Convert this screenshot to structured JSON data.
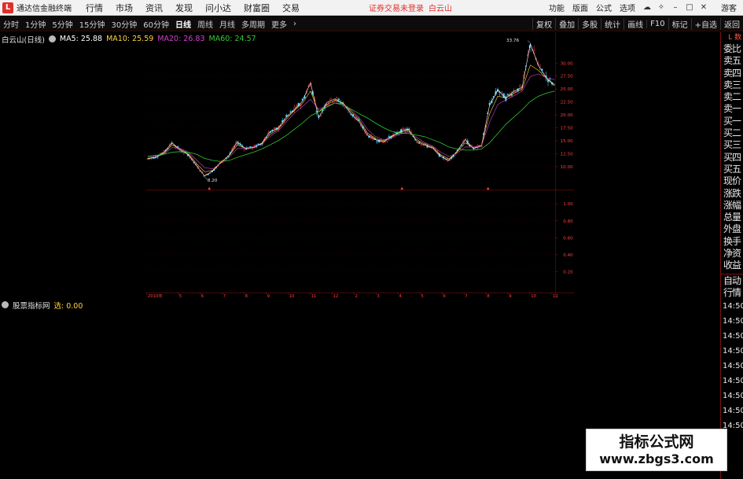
{
  "menubar": {
    "logo": "L",
    "app_title": "通达信金融终端",
    "items": [
      "行情",
      "市场",
      "资讯",
      "发现",
      "问小达",
      "财富圈",
      "交易"
    ],
    "login_status": "证券交易未登录",
    "login_stock": "白云山",
    "right_items": [
      "功能",
      "版面",
      "公式",
      "选项"
    ],
    "guest": "游客"
  },
  "toolbar": {
    "periods": [
      "分时",
      "1分钟",
      "5分钟",
      "15分钟",
      "30分钟",
      "60分钟",
      "日线",
      "周线",
      "月线",
      "多周期",
      "更多"
    ],
    "active_period": "日线",
    "right_buttons": [
      "复权",
      "叠加",
      "多股",
      "统计",
      "画线",
      "F10",
      "标记",
      "+自选",
      "返回"
    ]
  },
  "main_legend": {
    "name": "白云山(日线)",
    "ma5_label": "MA5: 25.88",
    "ma10_label": "MA10: 25.59",
    "ma20_label": "MA20: 26.83",
    "ma60_label": "MA60: 24.57"
  },
  "sub_legend": {
    "name": "股票指标网",
    "value_label": "选: 0.00"
  },
  "chart_data": {
    "type": "line",
    "series": [
      {
        "values": [
          11.5,
          11.9,
          12.8,
          14.6,
          13.2,
          12.3,
          10.2,
          8.2,
          9.2,
          10.8,
          12.2,
          14.8,
          13.5,
          13.7,
          14.5,
          16.7,
          17.4,
          19.5,
          21.0,
          22.6,
          26.2,
          19.4,
          22.4,
          23.1,
          22.2,
          20.2,
          18.6,
          16.1,
          15.2,
          14.8,
          15.9,
          16.8,
          17.3,
          15.0,
          14.2,
          13.6,
          12.0,
          11.2,
          13.0,
          15.2,
          13.5,
          14.0,
          21.9,
          24.8,
          23.2,
          24.6,
          25.3,
          33.76,
          29.5,
          27.1,
          25.8
        ]
      },
      {
        "values": [
          11.6,
          11.8,
          12.6,
          14.2,
          13.4,
          12.5,
          10.6,
          9.0,
          9.3,
          10.9,
          12.1,
          14.2,
          13.6,
          13.8,
          14.4,
          16.2,
          17.2,
          19.1,
          20.8,
          22.2,
          24.6,
          20.6,
          22.0,
          22.8,
          22.3,
          20.6,
          19.0,
          16.5,
          15.4,
          15.0,
          15.8,
          16.6,
          17.0,
          15.3,
          14.4,
          13.8,
          12.3,
          11.5,
          12.8,
          14.6,
          13.7,
          14.1,
          20.2,
          23.6,
          23.3,
          24.2,
          25.0,
          29.6,
          28.6,
          27.0,
          25.6
        ]
      },
      {
        "values": [
          11.8,
          11.9,
          12.4,
          13.7,
          13.5,
          12.8,
          11.3,
          9.8,
          9.6,
          10.7,
          11.8,
          13.5,
          13.6,
          13.8,
          14.3,
          15.8,
          16.9,
          18.6,
          20.3,
          21.6,
          23.0,
          21.1,
          21.7,
          22.3,
          22.1,
          20.9,
          19.4,
          17.2,
          15.8,
          15.2,
          15.6,
          16.3,
          16.7,
          15.7,
          14.7,
          14.0,
          12.8,
          12.0,
          12.6,
          13.8,
          13.8,
          14.0,
          18.6,
          22.0,
          22.9,
          23.7,
          24.6,
          27.4,
          27.9,
          27.2,
          26.8
        ]
      },
      {
        "values": [
          12.0,
          12.2,
          12.4,
          12.8,
          12.9,
          12.8,
          12.4,
          11.6,
          11.2,
          11.0,
          11.2,
          11.8,
          12.3,
          12.8,
          13.4,
          14.2,
          15.0,
          16.0,
          17.2,
          18.4,
          19.8,
          20.6,
          21.5,
          22.3,
          21.9,
          21.1,
          20.2,
          19.4,
          18.4,
          17.5,
          16.8,
          16.5,
          16.4,
          16.1,
          15.8,
          15.2,
          14.6,
          13.8,
          13.4,
          13.2,
          13.2,
          13.4,
          14.6,
          16.4,
          18.2,
          19.6,
          21.0,
          22.6,
          23.6,
          24.2,
          24.6
        ]
      }
    ],
    "ylim": [
      6.5,
      34.5
    ],
    "yticks": [
      "30.00",
      "27.50",
      "25.00",
      "22.50",
      "20.00",
      "17.50",
      "15.00",
      "12.50",
      "10.00"
    ],
    "ytick_values": [
      30,
      27.5,
      25,
      22.5,
      20,
      17.5,
      15,
      12.5,
      10
    ],
    "annotations": [
      {
        "text": "33.76",
        "value": 33.76
      },
      {
        "text": "8.20",
        "value": 8.2
      }
    ],
    "ma_colors": [
      "#ffffff",
      "#ffd33d",
      "#d040d0",
      "#33cc33"
    ],
    "grid": true,
    "sub_yticks": [
      "1.00",
      "0.80",
      "0.60",
      "0.40",
      "0.20"
    ],
    "sub_ylim": [
      0,
      1.08
    ],
    "x_tick_labels": [
      "2010年",
      "5",
      "6",
      "7",
      "8",
      "9",
      "10",
      "11",
      "12",
      "2",
      "3",
      "4",
      "5",
      "6",
      "7",
      "8",
      "9",
      "10",
      "11"
    ]
  },
  "right_panel": {
    "top_label": "L 数",
    "labels_top": [
      "委比",
      "卖五",
      "卖四",
      "卖三",
      "卖二",
      "卖一",
      "买一",
      "买二",
      "买三",
      "买四",
      "买五",
      "现价",
      "涨跌",
      "涨幅",
      "总量",
      "外盘",
      "换手",
      "净资",
      "收益"
    ],
    "labels_bottom": [
      "自动",
      "行情",
      "14:50",
      "14:50",
      "14:50",
      "14:50",
      "14:50",
      "14:50",
      "14:50",
      "14:50",
      "14:50"
    ]
  },
  "watermark": {
    "title": "指标公式网",
    "url": "www.zbgs3.com"
  },
  "colors": {
    "up": "#ff3c3c",
    "down": "#3cc8ff",
    "grid": "#6a0000",
    "axis_text": "#ff4040"
  }
}
